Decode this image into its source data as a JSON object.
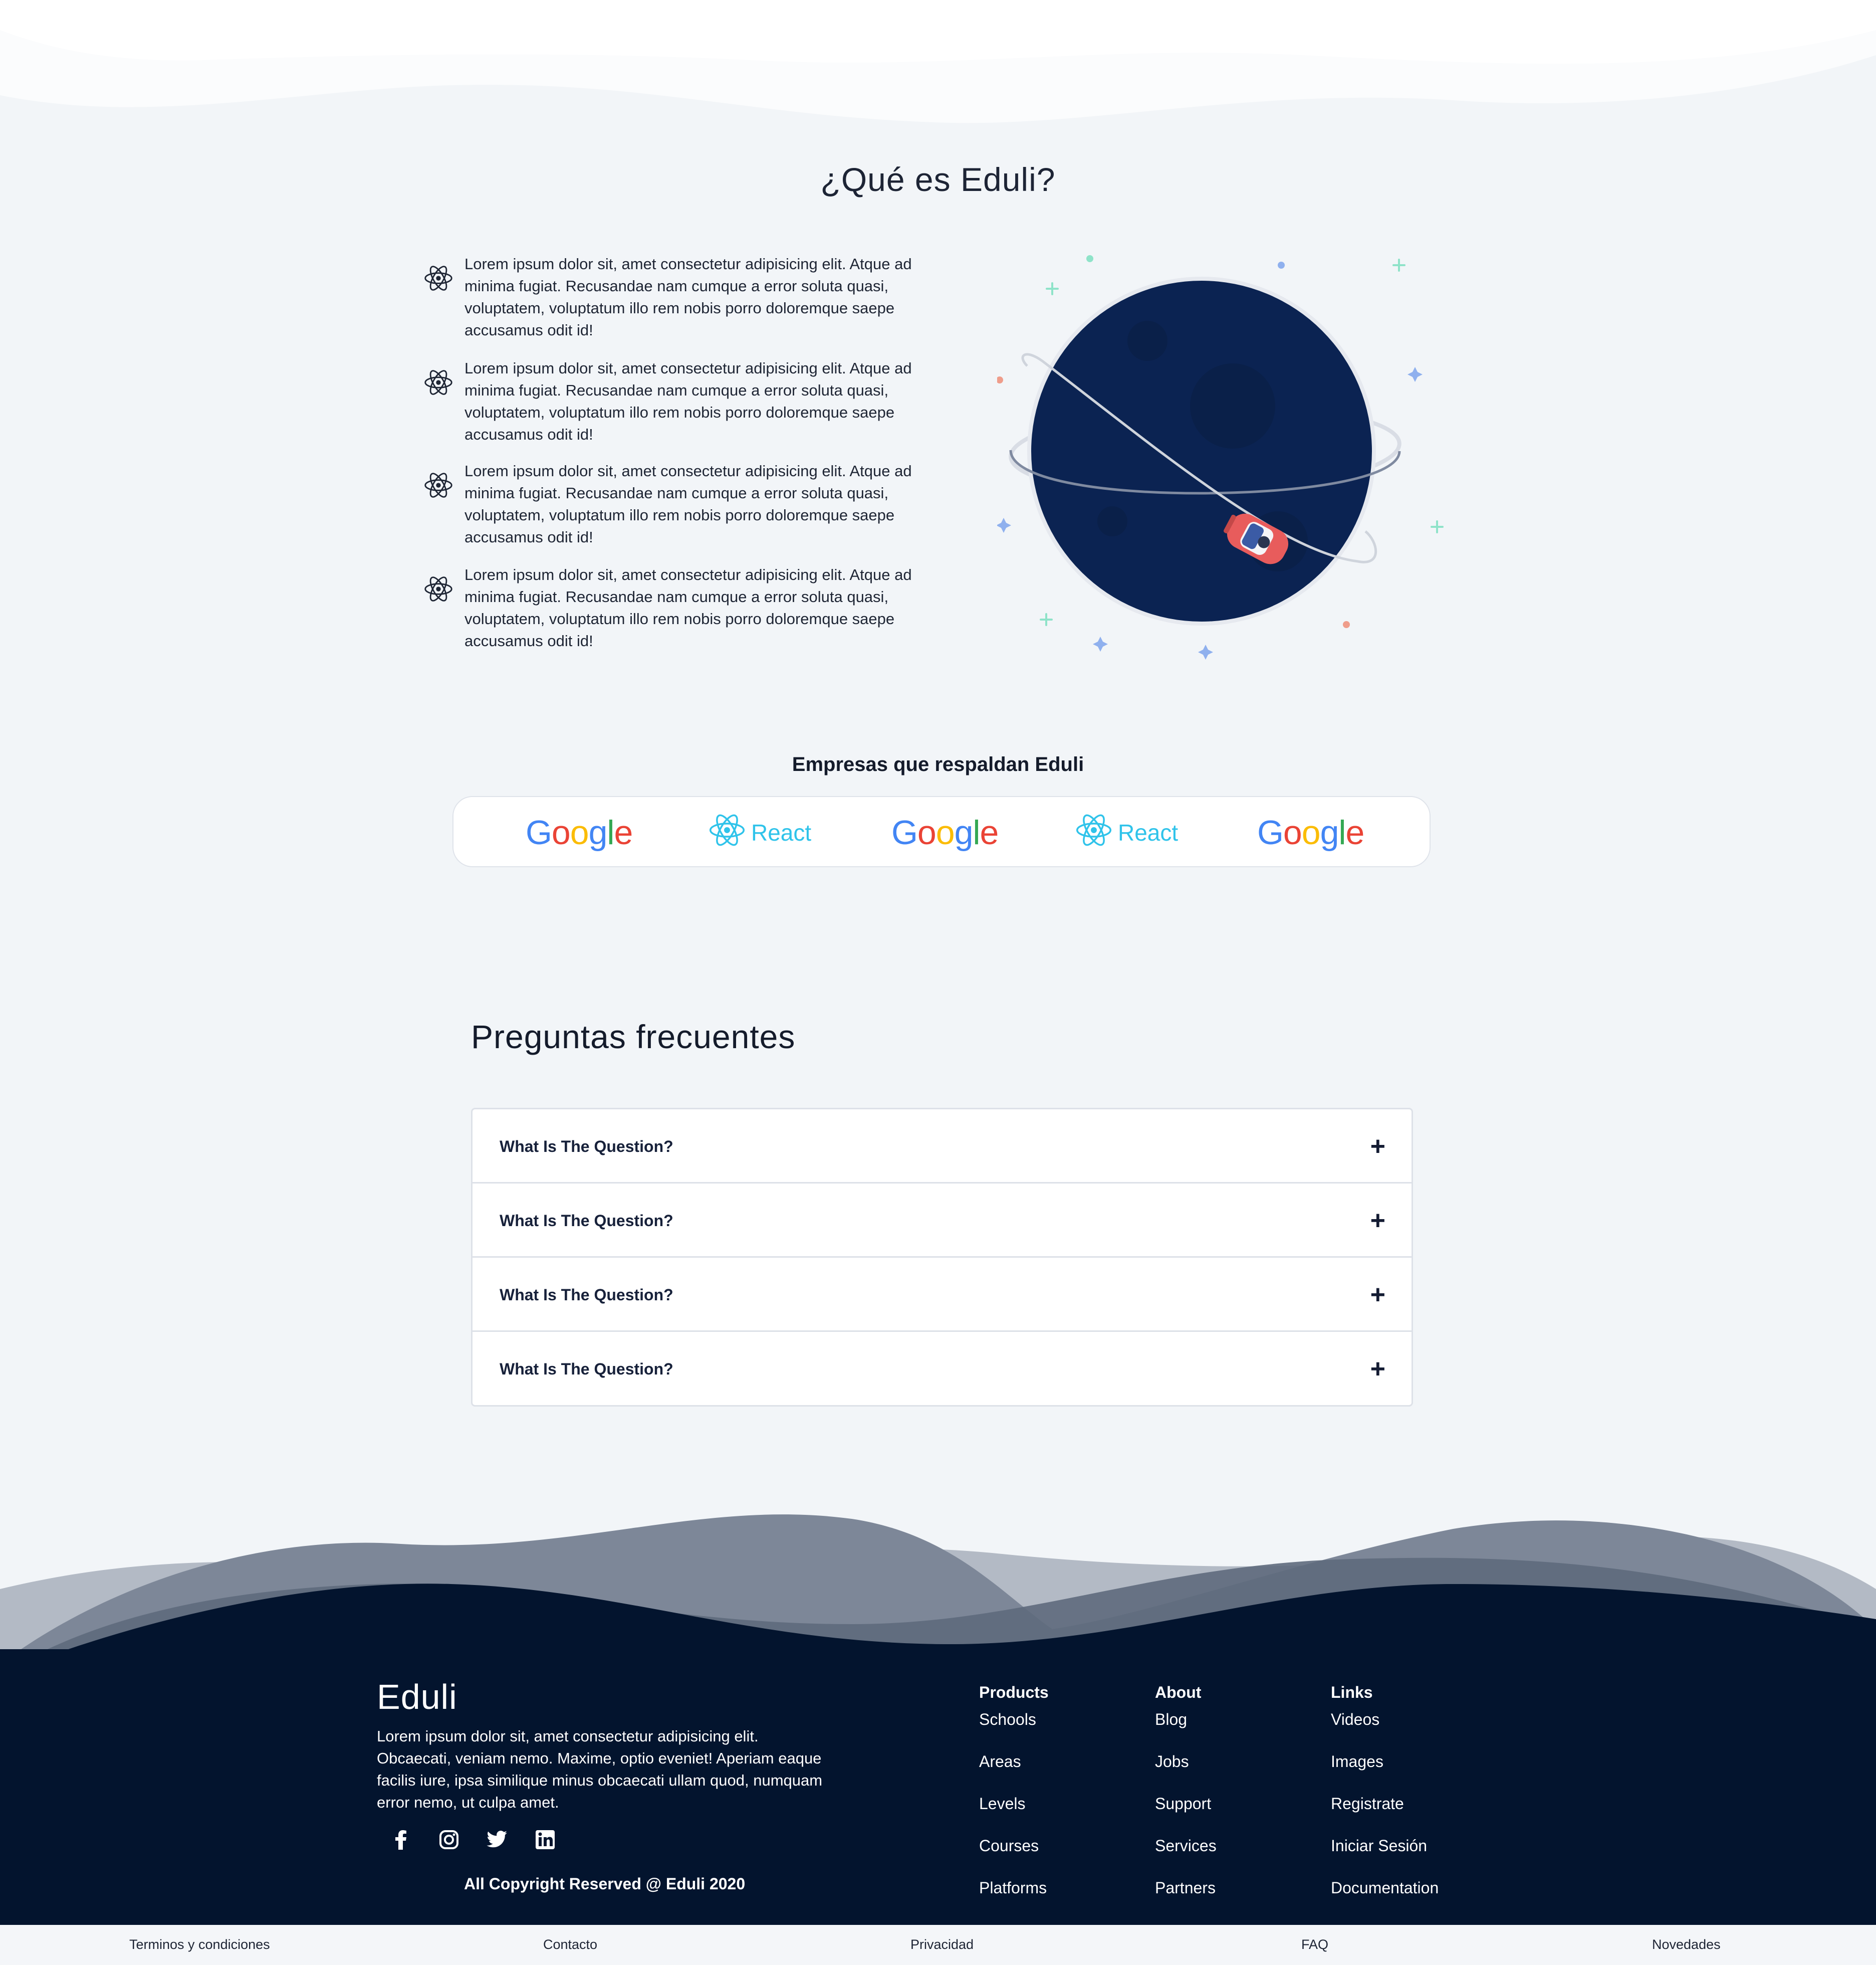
{
  "what": {
    "title": "¿Qué es Eduli?",
    "items": [
      "Lorem ipsum dolor sit, amet consectetur adipisicing elit. Atque ad minima fugiat. Recusandae nam cumque a error soluta quasi, voluptatem, voluptatum illo rem nobis porro doloremque saepe accusamus odit id!",
      "Lorem ipsum dolor sit, amet consectetur adipisicing elit. Atque ad minima fugiat. Recusandae nam cumque a error soluta quasi, voluptatem, voluptatum illo rem nobis porro doloremque saepe accusamus odit id!",
      "Lorem ipsum dolor sit, amet consectetur adipisicing elit. Atque ad minima fugiat. Recusandae nam cumque a error soluta quasi, voluptatem, voluptatum illo rem nobis porro doloremque saepe accusamus odit id!",
      "Lorem ipsum dolor sit, amet consectetur adipisicing elit. Atque ad minima fugiat. Recusandae nam cumque a error soluta quasi, voluptatem, voluptatum illo rem nobis porro doloremque saepe accusamus odit id!"
    ],
    "item_icon": "react-atom-icon",
    "illustration": "planet-with-car-illustration"
  },
  "sponsors": {
    "title": "Empresas que respaldan Eduli",
    "logos": [
      {
        "name": "Google",
        "icon": "google-logo"
      },
      {
        "name": "React",
        "icon": "react-logo"
      },
      {
        "name": "Google",
        "icon": "google-logo"
      },
      {
        "name": "React",
        "icon": "react-logo"
      },
      {
        "name": "Google",
        "icon": "google-logo"
      }
    ]
  },
  "faq": {
    "title": "Preguntas frecuentes",
    "items": [
      {
        "question": "What Is The Question?",
        "toggle": "+"
      },
      {
        "question": "What Is The Question?",
        "toggle": "+"
      },
      {
        "question": "What Is The Question?",
        "toggle": "+"
      },
      {
        "question": "What Is The Question?",
        "toggle": "+"
      }
    ]
  },
  "footer": {
    "brand": "Eduli",
    "description": "Lorem ipsum dolor sit, amet consectetur adipisicing elit. Obcaecati, veniam nemo. Maxime, optio eveniet! Aperiam eaque facilis iure, ipsa similique minus obcaecati ullam quod, numquam error nemo, ut culpa amet.",
    "social": [
      "facebook-icon",
      "instagram-icon",
      "twitter-icon",
      "linkedin-icon"
    ],
    "copyright": "All Copyright Reserved @ Eduli 2020",
    "columns": [
      {
        "heading": "Products",
        "links": [
          "Schools",
          "Areas",
          "Levels",
          "Courses",
          "Platforms"
        ]
      },
      {
        "heading": "About",
        "links": [
          "Blog",
          "Jobs",
          "Support",
          "Services",
          "Partners"
        ]
      },
      {
        "heading": "Links",
        "links": [
          "Videos",
          "Images",
          "Registrate",
          "Iniciar Sesión",
          "Documentation"
        ]
      }
    ],
    "bottom_links": [
      "Terminos y condiciones",
      "Contacto",
      "Privacidad",
      "FAQ",
      "Novedades"
    ]
  },
  "colors": {
    "background": "#f2f5f8",
    "footer": "#03142e",
    "planet": "#0b2352",
    "car": "#e85c5c",
    "react": "#2fc3ea"
  }
}
